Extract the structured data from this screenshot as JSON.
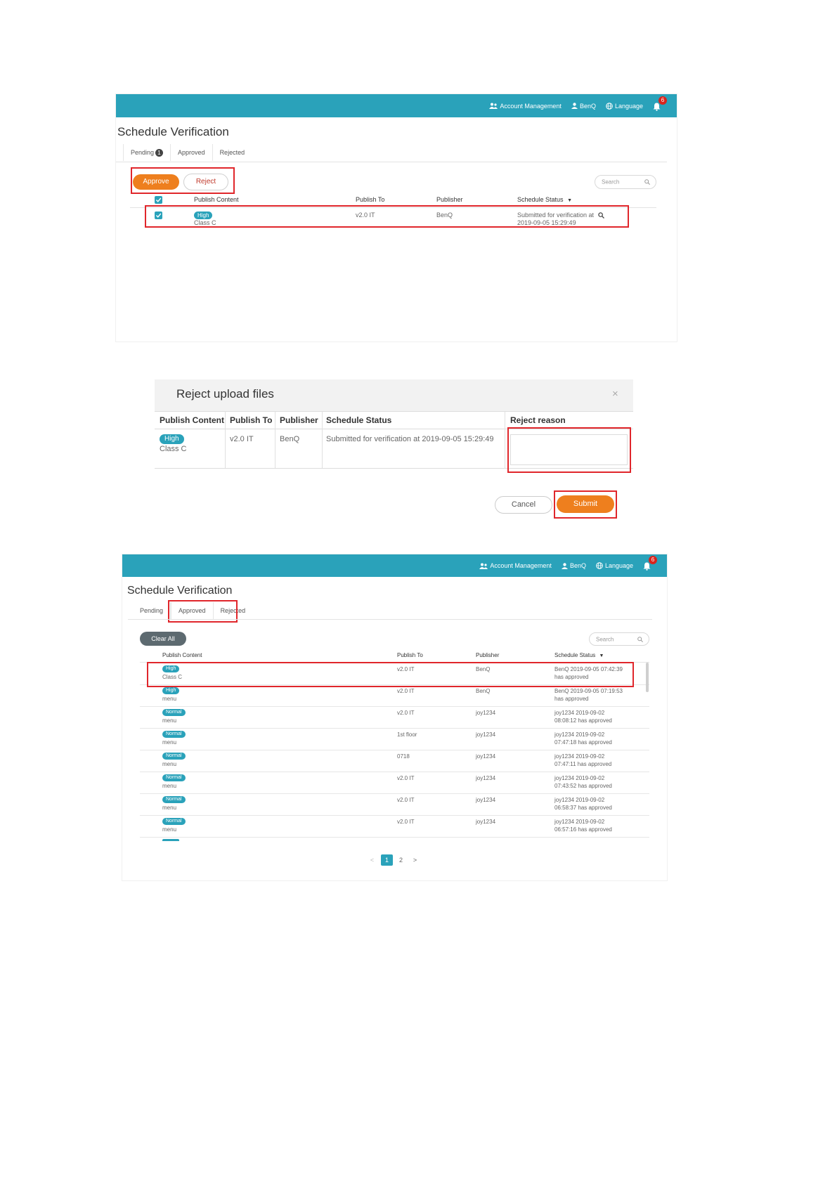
{
  "topbar": {
    "account_management": "Account Management",
    "user": "BenQ",
    "language": "Language",
    "notifications": "6"
  },
  "screen1": {
    "title": "Schedule Verification",
    "tabs": [
      {
        "label": "Pending",
        "count": "1"
      },
      {
        "label": "Approved"
      },
      {
        "label": "Rejected"
      }
    ],
    "approve_label": "Approve",
    "reject_label": "Reject",
    "search_placeholder": "Search",
    "headers": [
      "Publish Content",
      "Publish To",
      "Publisher",
      "Schedule Status"
    ],
    "row": {
      "priority": "High",
      "content": "Class C",
      "publish_to": "v2.0 IT",
      "publisher": "BenQ",
      "status_line1": "Submitted for verification at",
      "status_line2": "2019-09-05 15:29:49"
    }
  },
  "dialog": {
    "title": "Reject upload files",
    "close": "×",
    "headers": [
      "Publish Content",
      "Publish To",
      "Publisher",
      "Schedule Status",
      "Reject reason"
    ],
    "row": {
      "priority": "High",
      "content": "Class C",
      "publish_to": "v2.0 IT",
      "publisher": "BenQ",
      "status": "Submitted for verification at 2019-09-05 15:29:49"
    },
    "cancel_label": "Cancel",
    "submit_label": "Submit"
  },
  "screen3": {
    "title": "Schedule Verification",
    "tabs": [
      {
        "label": "Pending"
      },
      {
        "label": "Approved"
      },
      {
        "label": "Rejected"
      }
    ],
    "clear_all_label": "Clear All",
    "search_placeholder": "Search",
    "headers": [
      "Publish Content",
      "Publish To",
      "Publisher",
      "Schedule Status"
    ],
    "rows": [
      {
        "priority": "High",
        "content": "Class C",
        "publish_to": "v2.0 IT",
        "publisher": "BenQ",
        "status1": "BenQ 2019-09-05 07:42:39",
        "status2": "has approved"
      },
      {
        "priority": "High",
        "content": "menu",
        "publish_to": "v2.0 IT",
        "publisher": "BenQ",
        "status1": "BenQ 2019-09-05 07:19:53",
        "status2": "has approved"
      },
      {
        "priority": "Normal",
        "content": "menu",
        "publish_to": "v2.0 IT",
        "publisher": "joy1234",
        "status1": "joy1234 2019-09-02",
        "status2": "08:08:12 has approved"
      },
      {
        "priority": "Normal",
        "content": "menu",
        "publish_to": "1st floor",
        "publisher": "joy1234",
        "status1": "joy1234 2019-09-02",
        "status2": "07:47:18 has approved"
      },
      {
        "priority": "Normal",
        "content": "menu",
        "publish_to": "0718",
        "publisher": "joy1234",
        "status1": "joy1234 2019-09-02",
        "status2": "07:47:11 has approved"
      },
      {
        "priority": "Normal",
        "content": "menu",
        "publish_to": "v2.0 IT",
        "publisher": "joy1234",
        "status1": "joy1234 2019-09-02",
        "status2": "07:43:52 has approved"
      },
      {
        "priority": "Normal",
        "content": "menu",
        "publish_to": "v2.0 IT",
        "publisher": "joy1234",
        "status1": "joy1234 2019-09-02",
        "status2": "06:58:37 has approved"
      },
      {
        "priority": "Normal",
        "content": "menu",
        "publish_to": "v2.0 IT",
        "publisher": "joy1234",
        "status1": "joy1234 2019-09-02",
        "status2": "06:57:16 has approved"
      }
    ],
    "pagination": {
      "prev": "<",
      "pages": [
        "1",
        "2"
      ],
      "current": "1",
      "next": ">"
    }
  },
  "colors": {
    "accent": "#2aa2ba",
    "orange": "#ee7f1e",
    "highlight": "#e0262b"
  }
}
